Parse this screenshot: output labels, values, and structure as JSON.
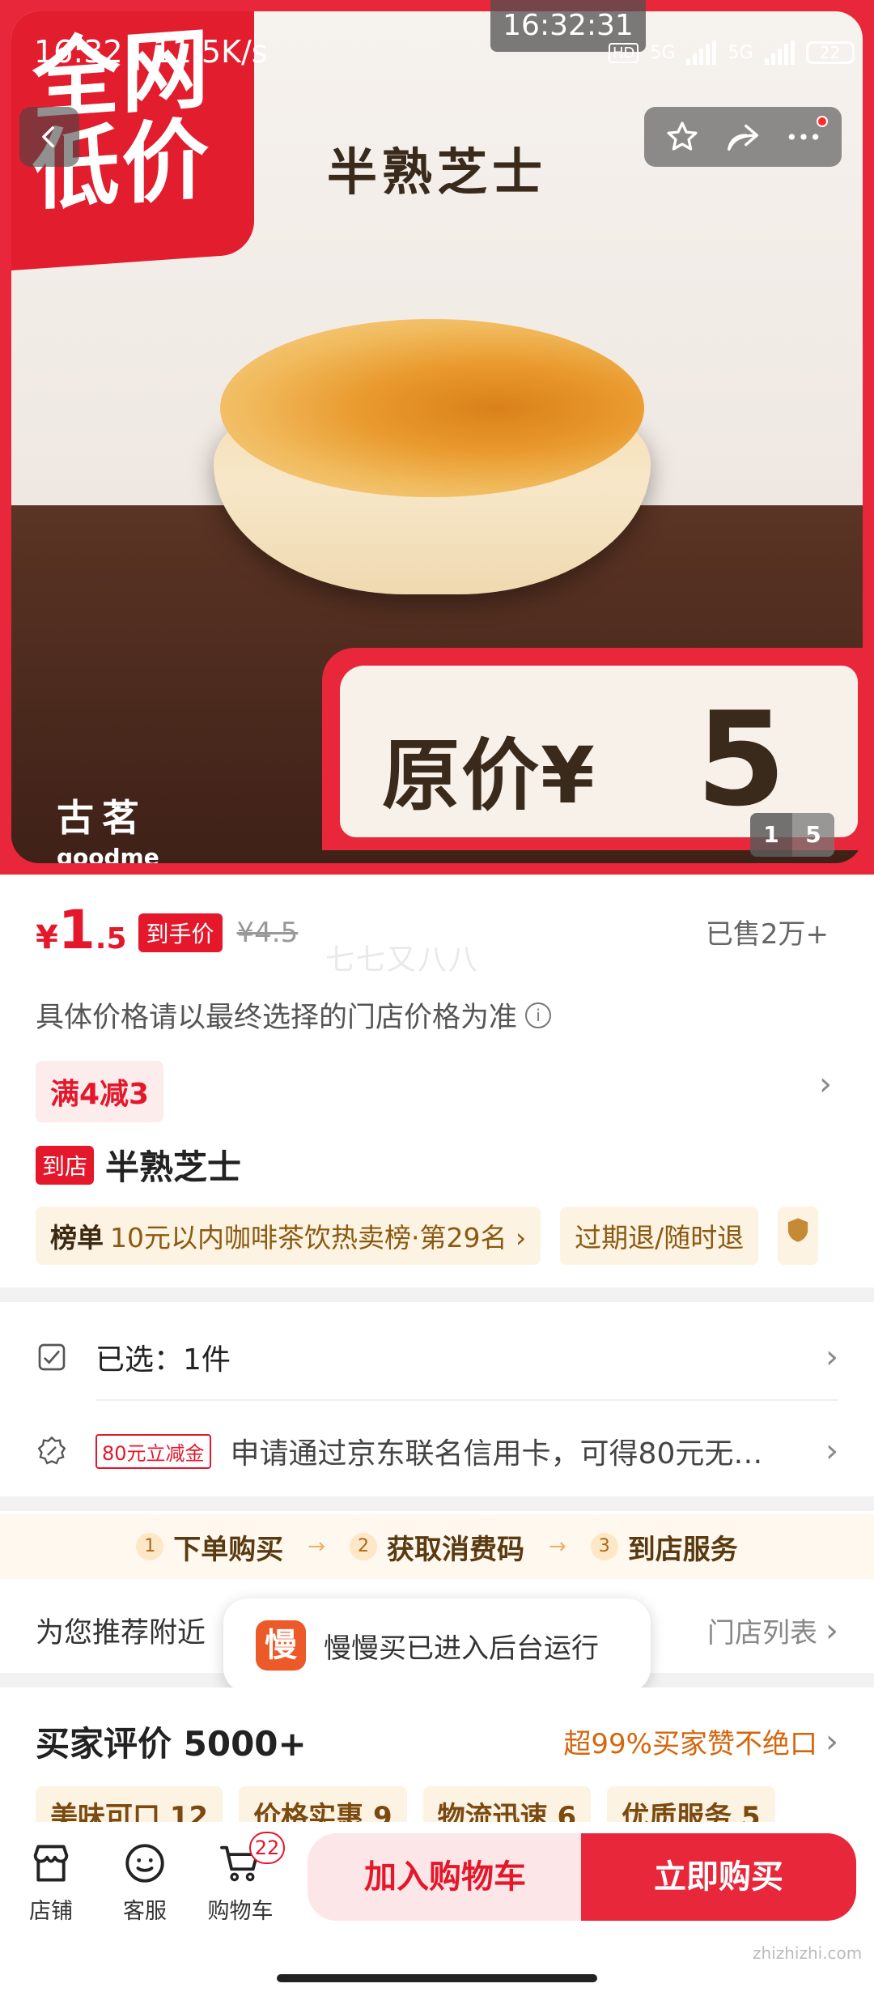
{
  "status_bar": {
    "left": "16:32 | 11.5K/s",
    "clock": "16:32:31",
    "network": "5G",
    "network2": "5G",
    "battery": "22"
  },
  "hero": {
    "banner_text": "全网低价",
    "product_name": "半熟芝士",
    "brand_cn": "古茗",
    "brand_en": "goodme",
    "price_label": "原价¥",
    "price_value": "5",
    "page_current": "1",
    "page_total": "5"
  },
  "price": {
    "symbol": "¥",
    "integer": "1",
    "decimal": ".5",
    "tag": "到手价",
    "original": "¥4.5",
    "sold": "已售2万+",
    "watermark": "七七又八八",
    "note": "具体价格请以最终选择的门店价格为准"
  },
  "promo": {
    "label": "满4减3"
  },
  "title": {
    "store_tag": "到店",
    "text": "半熟芝士"
  },
  "badges": {
    "rank_prefix": "榜单",
    "rank_text": "10元以内咖啡茶饮热卖榜·第29名 ›",
    "service": "过期退/随时退"
  },
  "options": {
    "selected": "已选：1件",
    "cash_tag": "80元立减金",
    "credit_text": "申请通过京东联名信用卡，可得80元无…"
  },
  "service": {
    "steps": [
      "下单购买",
      "获取消费码",
      "到店服务"
    ],
    "nearby": "为您推荐附近",
    "store_list": "门店列表"
  },
  "toast": {
    "logo": "慢",
    "text": "慢慢买已进入后台运行"
  },
  "reviews": {
    "title": "买家评价 5000+",
    "summary": "超99%买家赞不绝口",
    "tags": [
      "美味可口 12",
      "价格实惠 9",
      "物流迅速 6",
      "优质服务 5"
    ]
  },
  "bottom": {
    "store": "店铺",
    "service": "客服",
    "cart": "购物车",
    "cart_count": "22",
    "add_to_cart": "加入购物车",
    "buy_now": "立即购买",
    "corner_watermark": "zhizhizhi.com"
  },
  "colors": {
    "accent": "#e8273b",
    "price_red": "#e4172b",
    "badge_bg": "#fdf3e3"
  }
}
